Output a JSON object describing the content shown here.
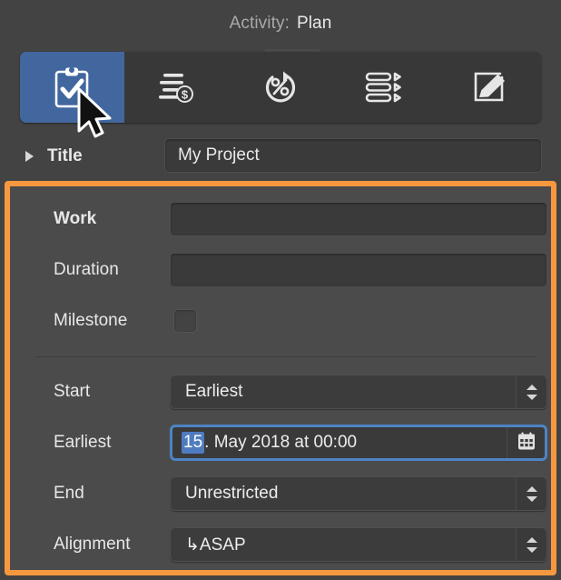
{
  "header": {
    "activity_label": "Activity:",
    "activity_value": "Plan"
  },
  "tabbar": {
    "tabs": [
      {
        "name": "plan-tab",
        "icon": "clipboard-check-icon",
        "selected": true
      },
      {
        "name": "cost-tab",
        "icon": "lines-dollar-icon",
        "selected": false
      },
      {
        "name": "progress-tab",
        "icon": "percent-refresh-icon",
        "selected": false
      },
      {
        "name": "schedule-tab",
        "icon": "gantt-list-icon",
        "selected": false
      },
      {
        "name": "notes-tab",
        "icon": "pencil-square-icon",
        "selected": false
      }
    ]
  },
  "title_row": {
    "label": "Title",
    "value": "My Project",
    "disclosure_icon": "triangle-right-icon"
  },
  "panel": {
    "accent_color": "#f7983f",
    "rows": [
      {
        "label": "Work",
        "bold": true,
        "type": "text",
        "value": ""
      },
      {
        "label": "Duration",
        "bold": false,
        "type": "text",
        "value": ""
      },
      {
        "label": "Milestone",
        "bold": false,
        "type": "checkbox",
        "checked": false
      }
    ],
    "start_label": "Start",
    "start_value": "Earliest",
    "earliest_label": "Earliest",
    "earliest_day": "15",
    "earliest_rest": ". May 2018 at 00:00",
    "calendar_icon": "calendar-icon",
    "end_label": "End",
    "end_value": "Unrestricted",
    "alignment_label": "Alignment",
    "alignment_value": "↳ASAP"
  },
  "colors": {
    "window_bg": "#434343",
    "panel_bg": "#4b4b4b",
    "selected_tab": "#42679f",
    "focus_ring": "#4e83c4",
    "selection": "#4f7cc0"
  },
  "cursor": {
    "icon": "mouse-pointer-icon"
  }
}
